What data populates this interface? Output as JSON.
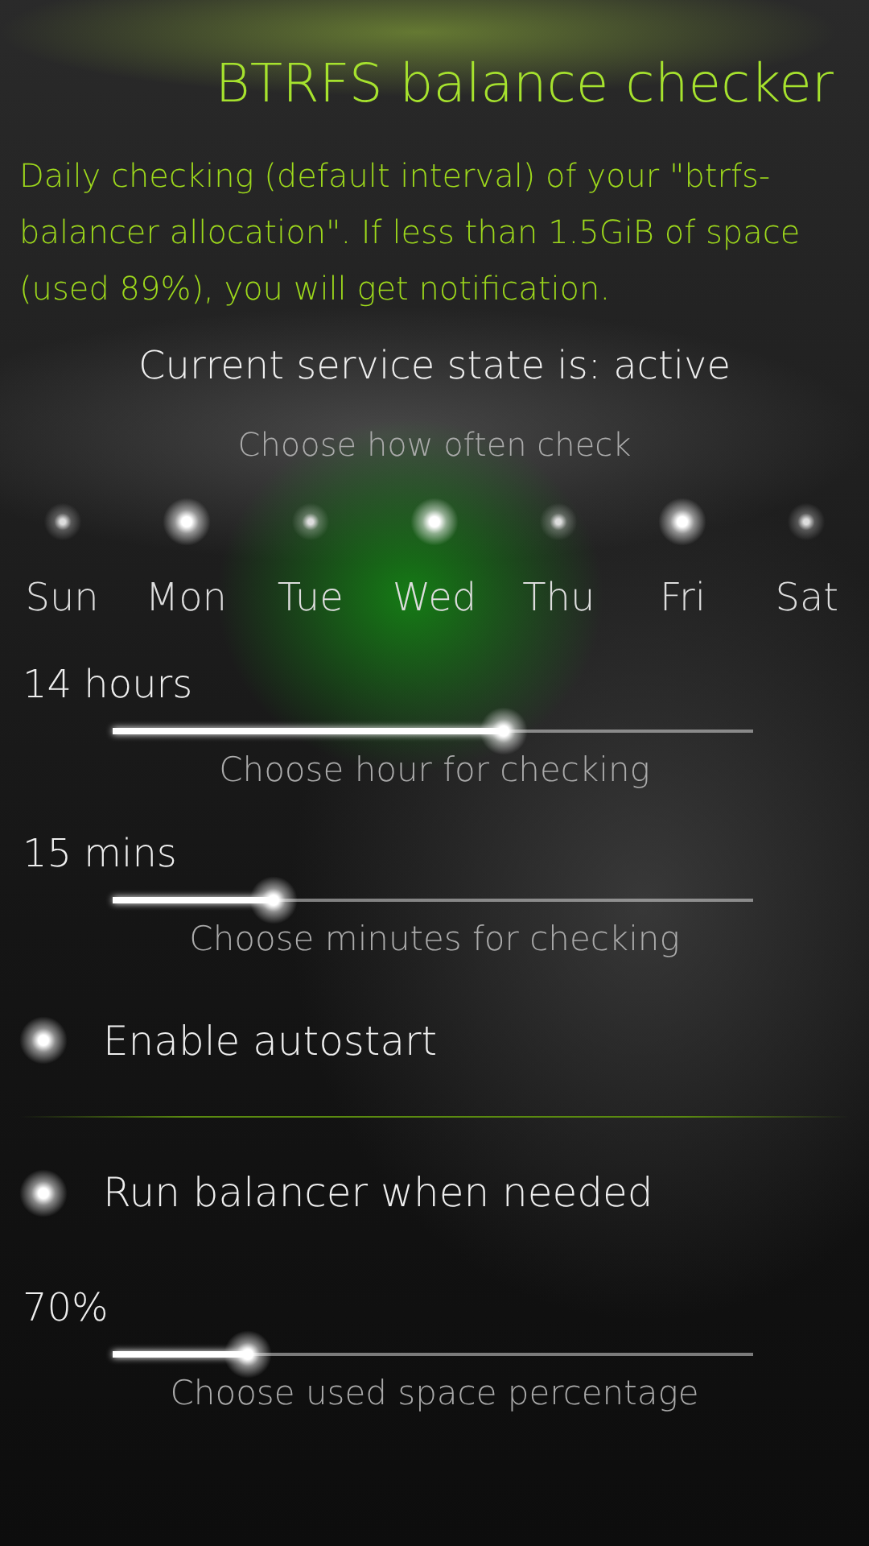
{
  "title": "BTRFS balance checker",
  "description": "Daily checking (default interval) of your \"btrfs-balancer allocation\". If less than 1.5GiB of space (used 89%), you will get notification.",
  "service_state": "Current service state is: active",
  "days_label": "Choose how often check",
  "days": [
    {
      "label": "Sun",
      "selected": false
    },
    {
      "label": "Mon",
      "selected": true
    },
    {
      "label": "Tue",
      "selected": false
    },
    {
      "label": "Wed",
      "selected": true
    },
    {
      "label": "Thu",
      "selected": false
    },
    {
      "label": "Fri",
      "selected": true
    },
    {
      "label": "Sat",
      "selected": false
    }
  ],
  "settings": [
    {
      "kind": "slider",
      "reading": "14 hours",
      "level": 0.61,
      "caption": "Choose hour for checking"
    },
    {
      "kind": "slider",
      "reading": "15 mins",
      "level": 0.25,
      "caption": "Choose minutes for checking"
    },
    {
      "kind": "switch",
      "label": "Enable autostart",
      "checked": true
    },
    {
      "kind": "divider"
    },
    {
      "kind": "switch",
      "label": "Run balancer when needed",
      "checked": true
    },
    {
      "kind": "slider",
      "reading": "70%",
      "level": 0.21,
      "caption": "Choose used space percentage"
    }
  ]
}
